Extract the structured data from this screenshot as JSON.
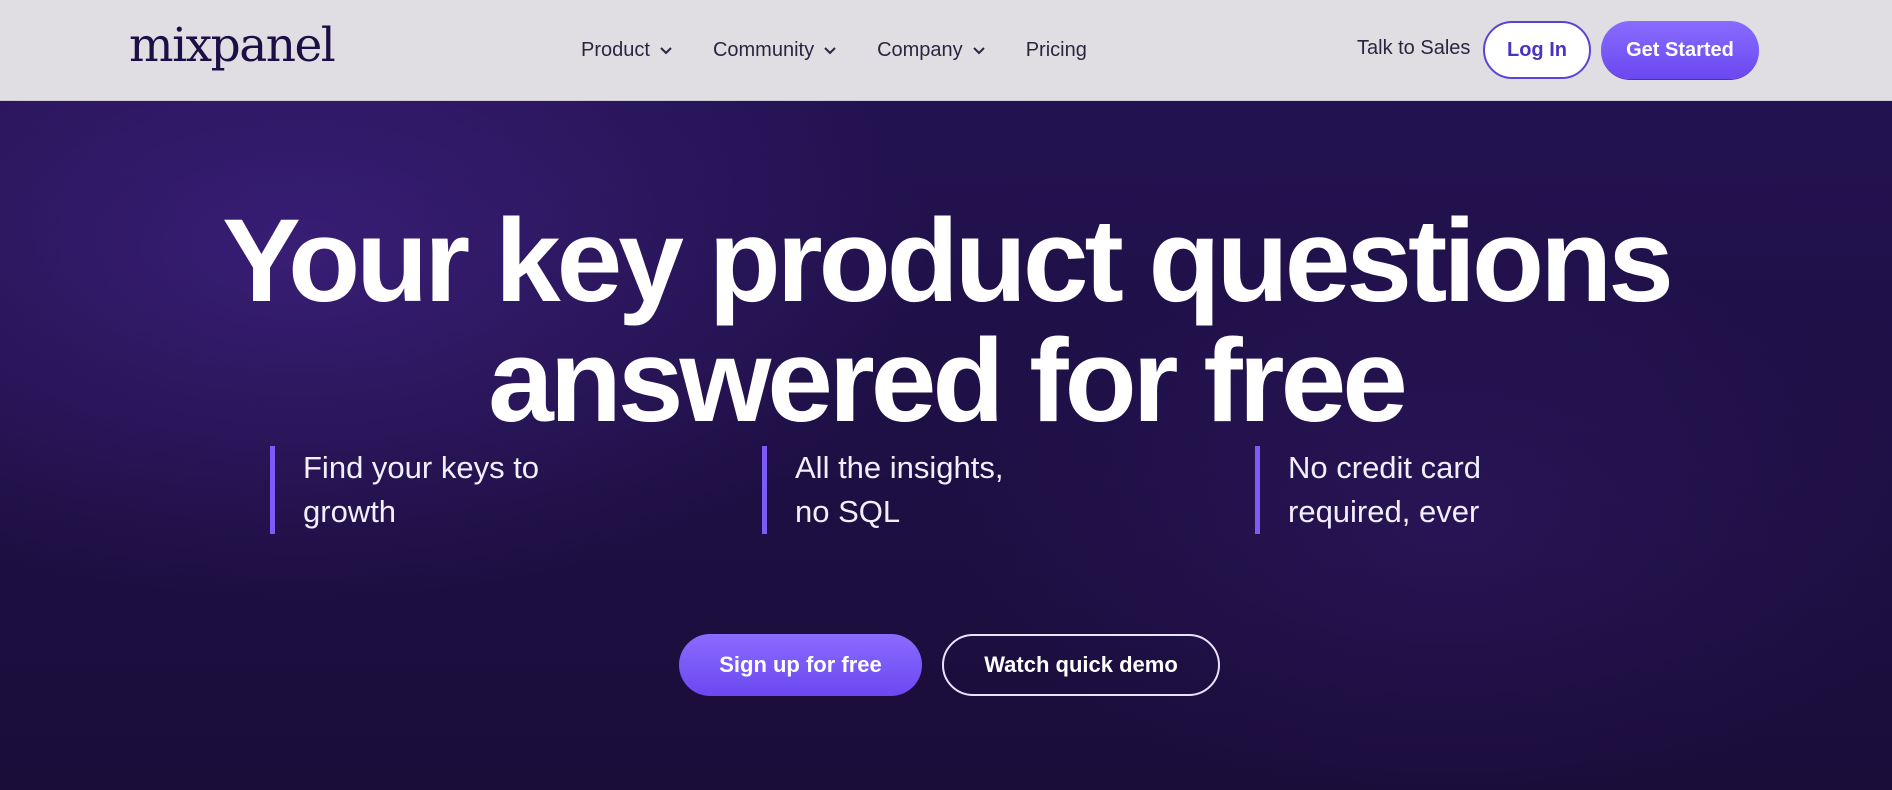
{
  "header": {
    "logo": "mixpanel",
    "nav": [
      {
        "label": "Product",
        "icon": "chevron-down-icon"
      },
      {
        "label": "Community",
        "icon": "chevron-down-icon"
      },
      {
        "label": "Company",
        "icon": "chevron-down-icon"
      },
      {
        "label": "Pricing"
      }
    ],
    "talk_to_sales": "Talk to Sales",
    "login": "Log In",
    "get_started": "Get Started"
  },
  "hero": {
    "headline_line1": "Your key product questions",
    "headline_line2": "answered for free",
    "features": [
      {
        "line1": "Find your keys to",
        "line2": "growth"
      },
      {
        "line1": "All the insights,",
        "line2": "no SQL"
      },
      {
        "line1": "No credit card",
        "line2": "required, ever"
      }
    ],
    "cta_primary": "Sign up for free",
    "cta_secondary": "Watch quick demo"
  },
  "colors": {
    "nav_bg": "#e1dee3",
    "hero_bg": "#1d0f42",
    "accent": "#7b5cf7",
    "logo": "#1b0f45"
  }
}
